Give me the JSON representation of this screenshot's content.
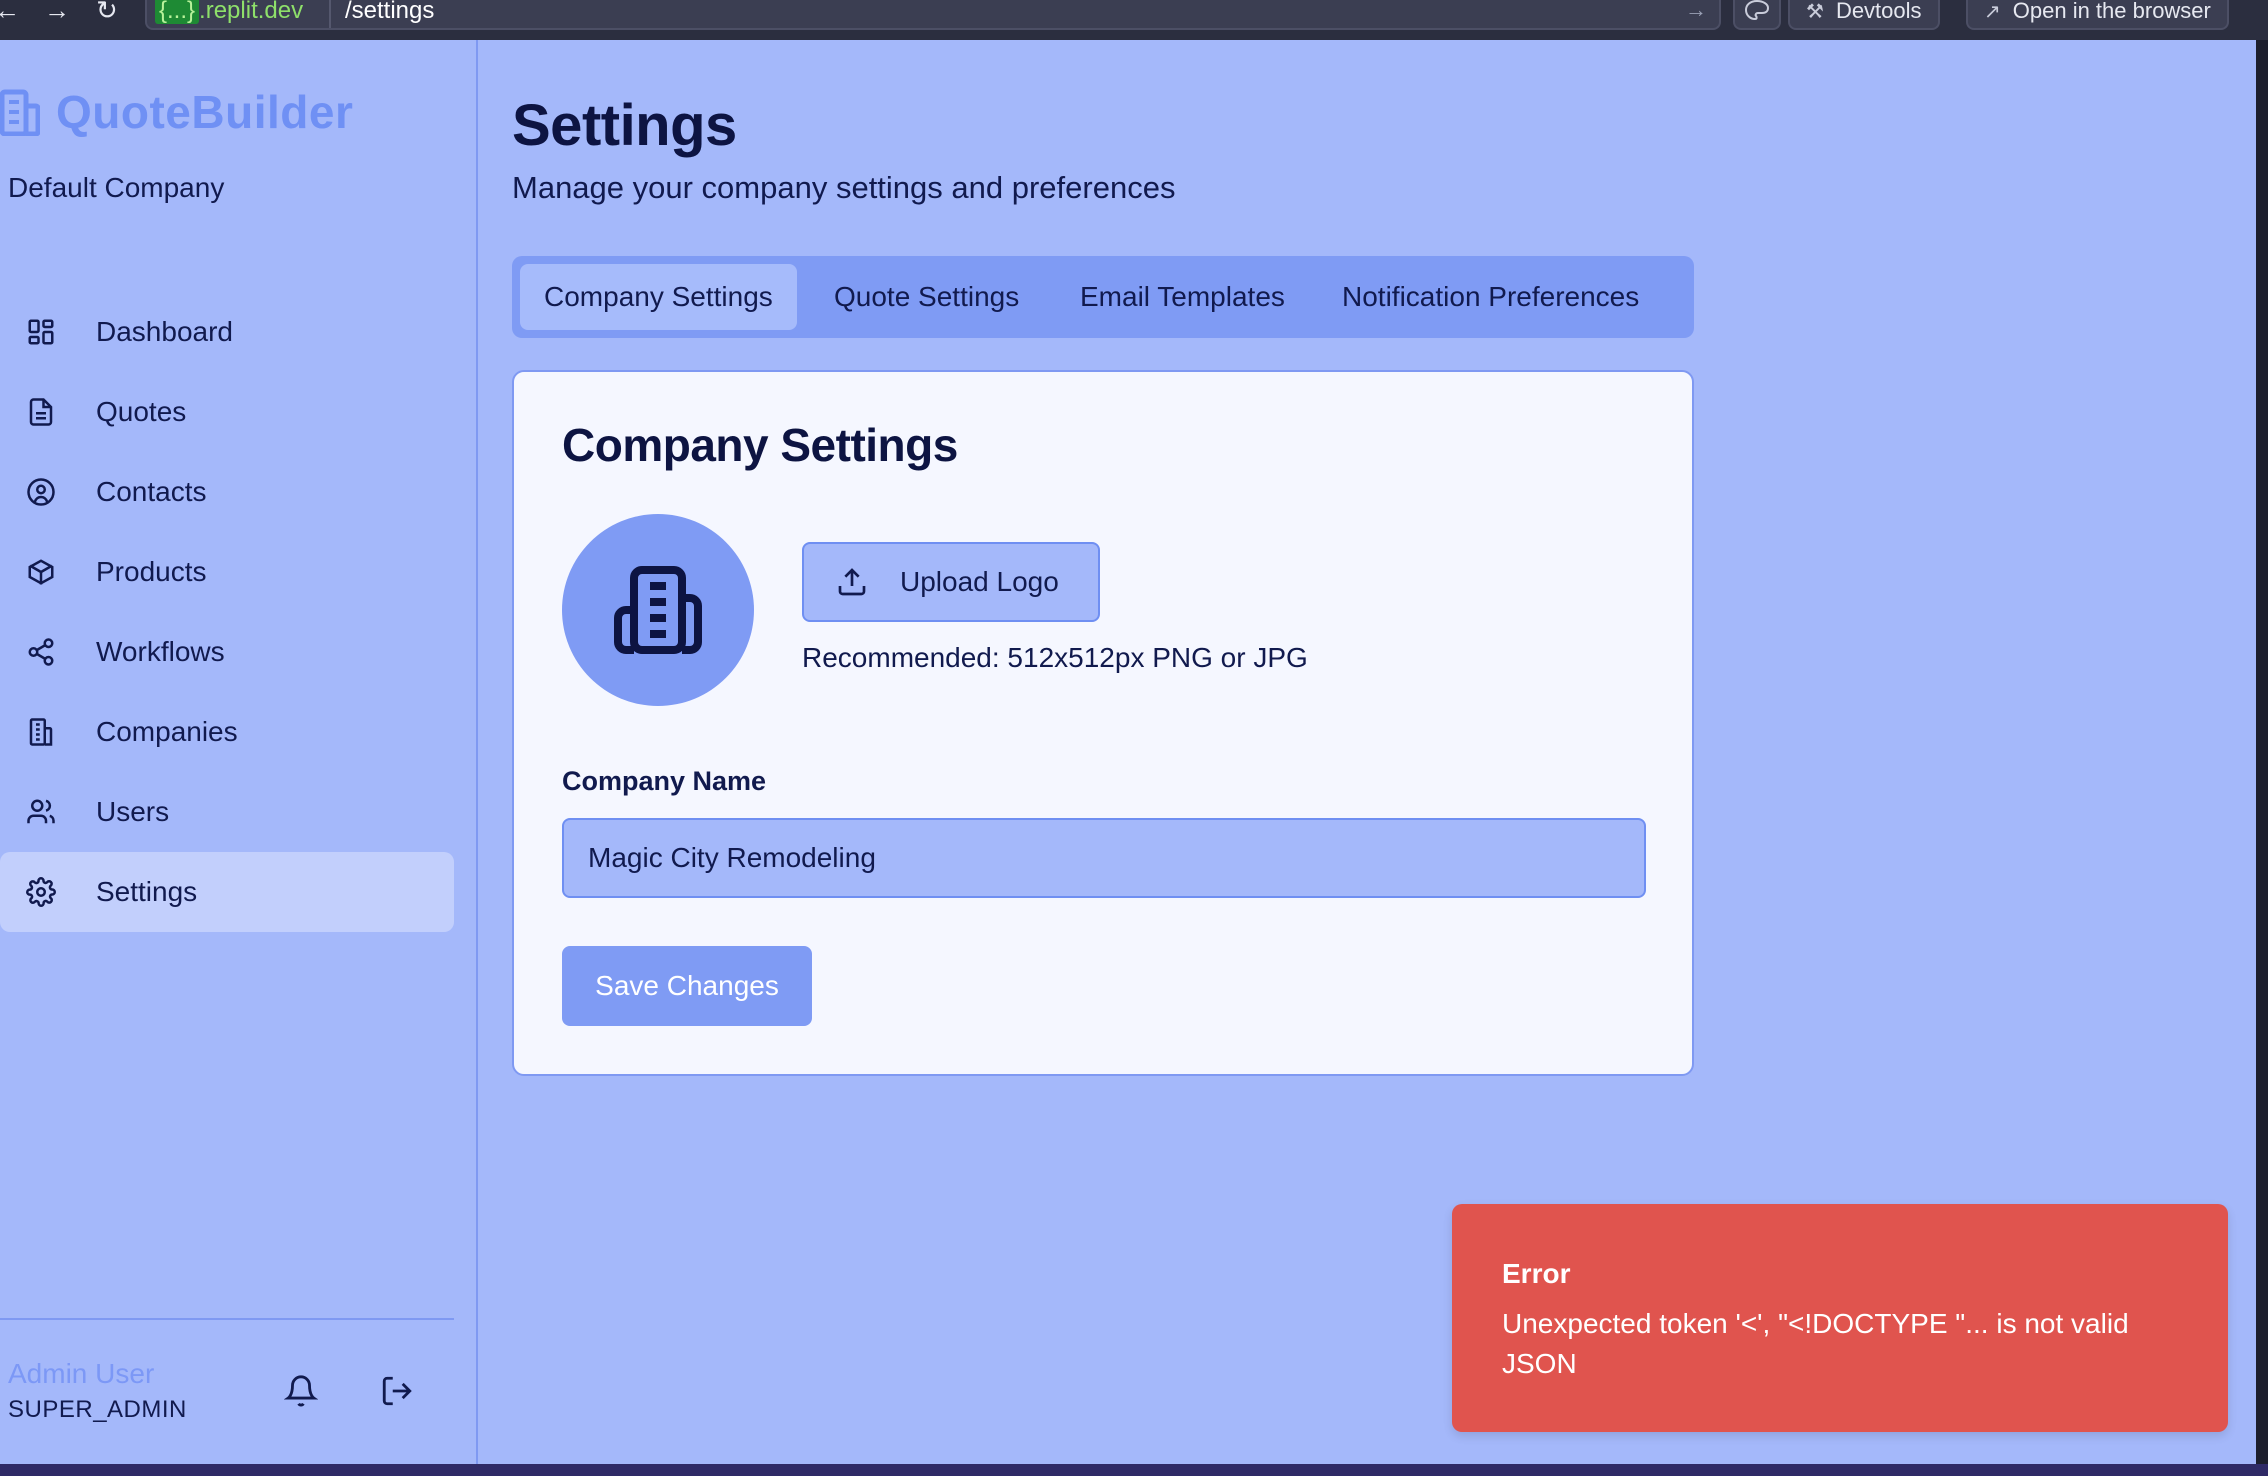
{
  "browser": {
    "url_host": ".replit.dev",
    "url_host_prefix": "{...}",
    "url_path": "/settings",
    "devtools_label": "Devtools",
    "open_browser_label": "Open in the browser",
    "nav_back": "←",
    "nav_forward": "→",
    "nav_reload": "↻",
    "go_glyph": "→"
  },
  "sidebar": {
    "brand": "QuoteBuilder",
    "company": "Default Company",
    "items": [
      {
        "label": "Dashboard",
        "icon": "dashboard-icon"
      },
      {
        "label": "Quotes",
        "icon": "file-icon"
      },
      {
        "label": "Contacts",
        "icon": "user-circle-icon"
      },
      {
        "label": "Products",
        "icon": "box-icon"
      },
      {
        "label": "Workflows",
        "icon": "share-icon"
      },
      {
        "label": "Companies",
        "icon": "building-icon"
      },
      {
        "label": "Users",
        "icon": "users-icon"
      },
      {
        "label": "Settings",
        "icon": "gear-icon",
        "active": true
      }
    ],
    "user": {
      "name": "Admin User",
      "role": "SUPER_ADMIN"
    }
  },
  "page": {
    "title": "Settings",
    "subtitle": "Manage your company settings and preferences"
  },
  "tabs": [
    {
      "label": "Company Settings",
      "active": true
    },
    {
      "label": "Quote Settings"
    },
    {
      "label": "Email Templates"
    },
    {
      "label": "Notification Preferences"
    }
  ],
  "card": {
    "title": "Company Settings",
    "upload_label": "Upload Logo",
    "recommended": "Recommended: 512x512px PNG or JPG",
    "company_name_label": "Company Name",
    "company_name_value": "Magic City Remodeling",
    "save_label": "Save Changes"
  },
  "toast": {
    "title": "Error",
    "message": "Unexpected token '<', \"<!DOCTYPE \"... is not valid JSON"
  },
  "colors": {
    "background": "#a4b8fa",
    "accent": "#7f9bf4",
    "brand": "#6f90f4",
    "text": "#111a4e",
    "error": "#e0544e"
  }
}
